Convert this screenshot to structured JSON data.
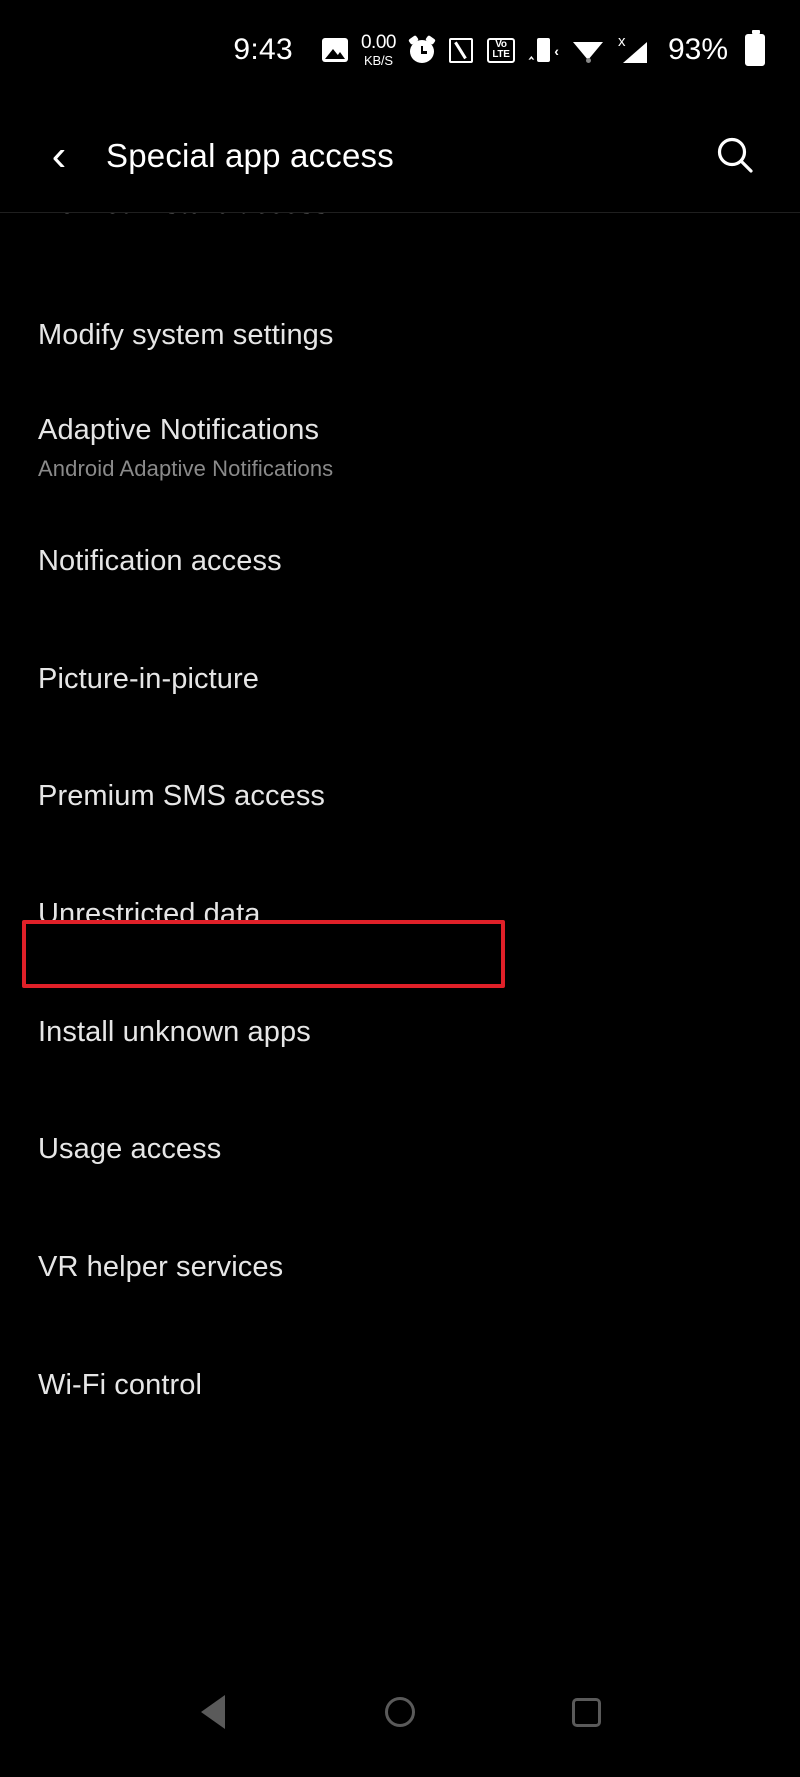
{
  "status_bar": {
    "time": "9:43",
    "network_speed_value": "0.00",
    "network_speed_unit": "KB/S",
    "volte_top": "Vo",
    "volte_bottom": "LTE",
    "nfc_label": "N",
    "signal_x": "x",
    "battery_percent": "93%",
    "icons": [
      "gallery-icon",
      "network-speed-icon",
      "alarm-icon",
      "nfc-icon",
      "volte-icon",
      "vibrate-icon",
      "wifi-icon",
      "cellular-signal-icon",
      "battery-icon"
    ]
  },
  "header": {
    "back_label": "‹",
    "title": "Special app access",
    "search_icon": "search-icon"
  },
  "list": {
    "clipped_top_item": "Do Not Disturb access",
    "items": [
      {
        "title": "Modify system settings",
        "subtitle": ""
      },
      {
        "title": "Adaptive Notifications",
        "subtitle": "Android Adaptive Notifications"
      },
      {
        "title": "Notification access",
        "subtitle": ""
      },
      {
        "title": "Picture-in-picture",
        "subtitle": ""
      },
      {
        "title": "Premium SMS access",
        "subtitle": ""
      },
      {
        "title": "Unrestricted data",
        "subtitle": ""
      },
      {
        "title": "Install unknown apps",
        "subtitle": ""
      },
      {
        "title": "Usage access",
        "subtitle": ""
      },
      {
        "title": "VR helper services",
        "subtitle": ""
      },
      {
        "title": "Wi-Fi control",
        "subtitle": ""
      }
    ],
    "highlighted_item_index": 6
  },
  "nav_bar": {
    "back": "nav-back-icon",
    "home": "nav-home-icon",
    "recents": "nav-recents-icon"
  },
  "colors": {
    "background": "#000000",
    "primary_text": "#e6e6e6",
    "secondary_text": "#8a8a8a",
    "highlight": "#e02028",
    "nav_icon": "#5a5a5a"
  }
}
